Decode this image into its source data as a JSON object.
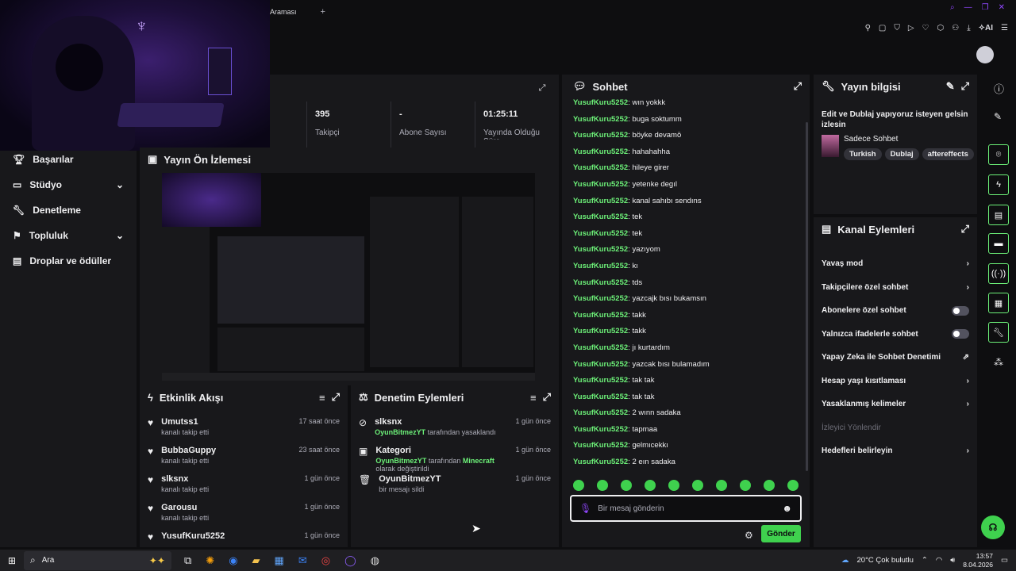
{
  "tab": {
    "label": "Araması",
    "new_tab": "+"
  },
  "stats": [
    {
      "value": "395",
      "label": "Takipçi"
    },
    {
      "value": "-",
      "label": "Abone Sayısı"
    },
    {
      "value": "01:25:11",
      "label": "Yayında Olduğu Süre"
    }
  ],
  "nav": {
    "items": [
      {
        "label": "Başarılar",
        "chevron": false
      },
      {
        "label": "Stüdyo",
        "chevron": true
      },
      {
        "label": "Denetleme",
        "chevron": false
      },
      {
        "label": "Topluluk",
        "chevron": true
      },
      {
        "label": "Droplar ve ödüller",
        "chevron": false
      }
    ]
  },
  "preview": {
    "title": "Yayın Ön İzlemesi"
  },
  "activity": {
    "title": "Etkinlik Akışı",
    "rows": [
      {
        "name": "Umutss1",
        "sub": "kanalı takip etti",
        "time": "17 saat önce"
      },
      {
        "name": "BubbaGuppy",
        "sub": "kanalı takip etti",
        "time": "23 saat önce"
      },
      {
        "name": "slksnx",
        "sub": "kanalı takip etti",
        "time": "1 gün önce"
      },
      {
        "name": "Garousu",
        "sub": "kanalı takip etti",
        "time": "1 gün önce"
      },
      {
        "name": "YusufKuru5252",
        "sub": "",
        "time": "1 gün önce"
      }
    ]
  },
  "moderation": {
    "title": "Denetim Eylemleri",
    "rows": [
      {
        "name": "slksnx",
        "by": "OyunBitmezYT",
        "text": " tarafından yasaklandı",
        "extra": "",
        "extra2": "",
        "time": "1 gün önce"
      },
      {
        "name": "Kategori",
        "by": "OyunBitmezYT",
        "text": " tarafından ",
        "extra": "Minecraft",
        "extra2": " olarak değiştirildi",
        "time": "1 gün önce"
      },
      {
        "name": "OyunBitmezYT",
        "by": "",
        "text": "bir mesajı sildi",
        "extra": "",
        "extra2": "",
        "time": "1 gün önce"
      }
    ]
  },
  "chat": {
    "title": "Sohbet",
    "user": "YusufKuru5252",
    "messages": [
      "wın yokkk",
      "buga soktumm",
      "böyke devamö",
      "hahahahha",
      "hileye girer",
      "yetenke degıl",
      "kanal sahıbı sendıns",
      "tek",
      "tek",
      "yazıyom",
      "kı",
      "tds",
      "yazcajk bısı bukamsın",
      "takk",
      "takk",
      "jı kurtardım",
      "yazcak bısı bulamadım",
      "tak tak",
      "tak tak",
      "2 wınn sadaka",
      "tapmaa",
      "gelmıcekkı",
      "2 eın sadaka"
    ],
    "placeholder": "Bir mesaj gönderin",
    "send": "Gönder"
  },
  "stream_info": {
    "title": "Yayın bilgisi",
    "stream_title": "Edit ve Dublaj yapıyoruz isteyen gelsin izlesin",
    "category": "Sadece Sohbet",
    "tags": [
      "Turkish",
      "Dublaj",
      "aftereffects"
    ]
  },
  "channel_actions": {
    "title": "Kanal Eylemleri",
    "rows": [
      {
        "label": "Yavaş mod",
        "type": "chevron"
      },
      {
        "label": "Takipçilere özel sohbet",
        "type": "chevron"
      },
      {
        "label": "Abonelere özel sohbet",
        "type": "toggle"
      },
      {
        "label": "Yalnızca ifadelerle sohbet",
        "type": "toggle"
      },
      {
        "label": "Yapay Zeka ile Sohbet Denetimi",
        "type": "external"
      },
      {
        "label": "Hesap yaşı kısıtlaması",
        "type": "chevron"
      },
      {
        "label": "Yasaklanmış kelimeler",
        "type": "chevron"
      },
      {
        "label": "İzleyici Yönlendir",
        "type": "disabled"
      },
      {
        "label": "Hedefleri belirleyin",
        "type": "chevron"
      }
    ]
  },
  "taskbar": {
    "search": "Ara",
    "weather": "20°C  Çok bulutlu",
    "time": "13:57",
    "date": "8.04.2026"
  },
  "colors": {
    "accent": "#6cf078",
    "bg": "#0e0e10",
    "panel": "#18181b"
  }
}
